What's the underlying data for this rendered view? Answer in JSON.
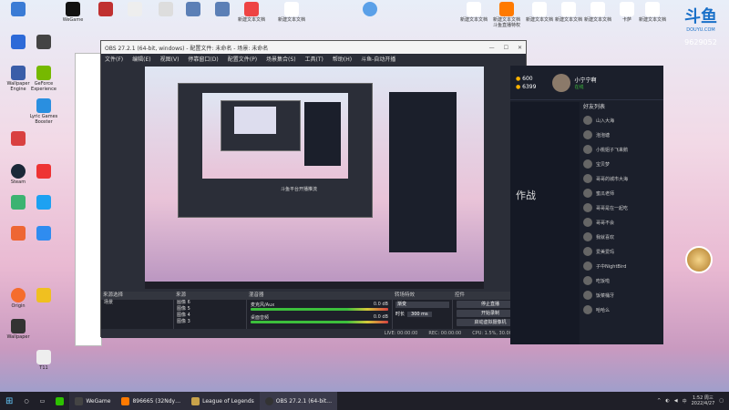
{
  "desktop_icons_top": [
    "",
    "WeGame",
    "",
    "",
    "",
    "",
    "",
    "新建文本文档",
    "新建文本文档",
    "新建文本文档",
    "新建文本文档 斗鱼直播特权",
    "新建文本文档",
    "新建文本文档",
    "新建文本文档",
    "新建文本文档",
    "卡萨",
    "新建文本文档"
  ],
  "desktop_icons_left": [
    "",
    "",
    "Wallpaper Engine",
    "GeForce Experience",
    "Lyric Games Booster",
    "",
    "Steam",
    "",
    "",
    "",
    "",
    "",
    "Origin",
    "",
    "Wallpaper",
    "T11"
  ],
  "douyu_logo": "斗鱼",
  "douyu_site": "DOUYU.COM",
  "douyu_number": "9629052",
  "obs": {
    "title": "OBS 27.2.1 (64-bit, windows) - 配置文件: 未命名 - 场景: 未命名",
    "menu": [
      "文件(F)",
      "编辑(E)",
      "视图(V)",
      "停靠窗口(D)",
      "配置文件(P)",
      "场景集合(S)",
      "工具(T)",
      "帮助(H)",
      "斗鱼-自动开播"
    ],
    "scene_header": "来源选择",
    "sources_header": "来源",
    "mixer_header": "混音器",
    "transitions_header": "转场特效",
    "controls_header": "控件",
    "scene_item": "场景",
    "sources": [
      "图像 6",
      "图像 5",
      "图像 4",
      "图像 3",
      "图像 2",
      "文本 (GDI+) 2"
    ],
    "mixer": [
      {
        "label": "麦克风/Aux",
        "db": "0.0 dB"
      },
      {
        "label": "桌面音频",
        "db": "0.0 dB"
      }
    ],
    "transition_type": "渐变",
    "duration_label": "时长",
    "duration": "300 ms",
    "controls": [
      "停止直播",
      "开始录制",
      "启动虚拟摄像机",
      "工作室模式",
      "设置",
      "退出"
    ],
    "status": {
      "live": "LIVE: 00:00:00",
      "rec": "REC: 00:00:00",
      "cpu": "CPU: 1.5%, 30.00 fps"
    },
    "preview_caption": "斗鱼平台开播推流"
  },
  "douyu_panel": {
    "user": "小宁宁啊",
    "online": "在线",
    "coins": "600",
    "fishballs": "6399",
    "title_text": "作战",
    "friends_header": "好友列表",
    "friends": [
      "山入大海",
      "泡泡塘",
      "小桃姐子飞来鹅",
      "宝贝梦",
      "哥哥的城市大海",
      "蜜瓜老师",
      "哥哥是在一起吃",
      "哥哥不会",
      "我就喜欢",
      "爱美爱玛",
      "子中NightBird",
      "吃饭啦",
      "饭菜桶牙",
      "哈哈么",
      "三道"
    ],
    "friend_status": "离线"
  },
  "taskbar": {
    "items": [
      "WeGame",
      "896665 (32Ndy…",
      "League of Legends",
      "OBS 27.2.1 (64-bit…"
    ],
    "time": "1:52 周三",
    "date": "2022/4/27",
    "lang": "中"
  },
  "colors": {
    "obs_bg": "#2b2e38",
    "douyu_bg": "#1b1f2b",
    "accent": "#ff7a00"
  }
}
